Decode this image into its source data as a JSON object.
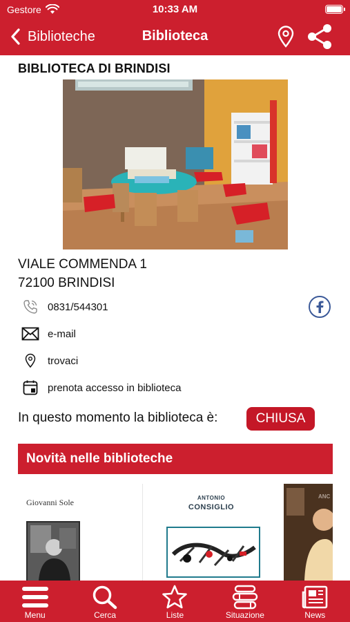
{
  "status_bar": {
    "carrier": "Gestore",
    "time": "10:33 AM"
  },
  "nav": {
    "back_label": "Biblioteche",
    "title": "Biblioteca",
    "icons": [
      "map-pin-icon",
      "share-icon"
    ]
  },
  "library": {
    "name": "BIBLIOTECA DI BRINDISI",
    "address_line1": "VIALE COMMENDA 1",
    "address_line2": "72100 BRINDISI"
  },
  "contacts": {
    "phone": "0831/544301",
    "email": "e-mail",
    "location": "trovaci",
    "booking": "prenota accesso in biblioteca"
  },
  "opening_status": {
    "label": "In questo momento la biblioteca è:",
    "value": "CHIUSA",
    "badge_color": "#c41727"
  },
  "news": {
    "header": "Novità nelle biblioteche",
    "books": [
      {
        "author": "Giovanni Sole"
      },
      {
        "author_first": "ANTONIO",
        "author_last": "CONSIGLIO"
      },
      {
        "author_first": "ANC"
      }
    ]
  },
  "tab_bar": {
    "items": [
      {
        "label": "Menu",
        "icon": "hamburger-menu-icon"
      },
      {
        "label": "Cerca",
        "icon": "search-icon"
      },
      {
        "label": "Liste",
        "icon": "star-icon"
      },
      {
        "label": "Situazione",
        "icon": "books-stack-icon"
      },
      {
        "label": "News",
        "icon": "newspaper-icon"
      }
    ]
  },
  "colors": {
    "brand_red": "#cc1f2e",
    "icon_blue": "#3b5998"
  }
}
